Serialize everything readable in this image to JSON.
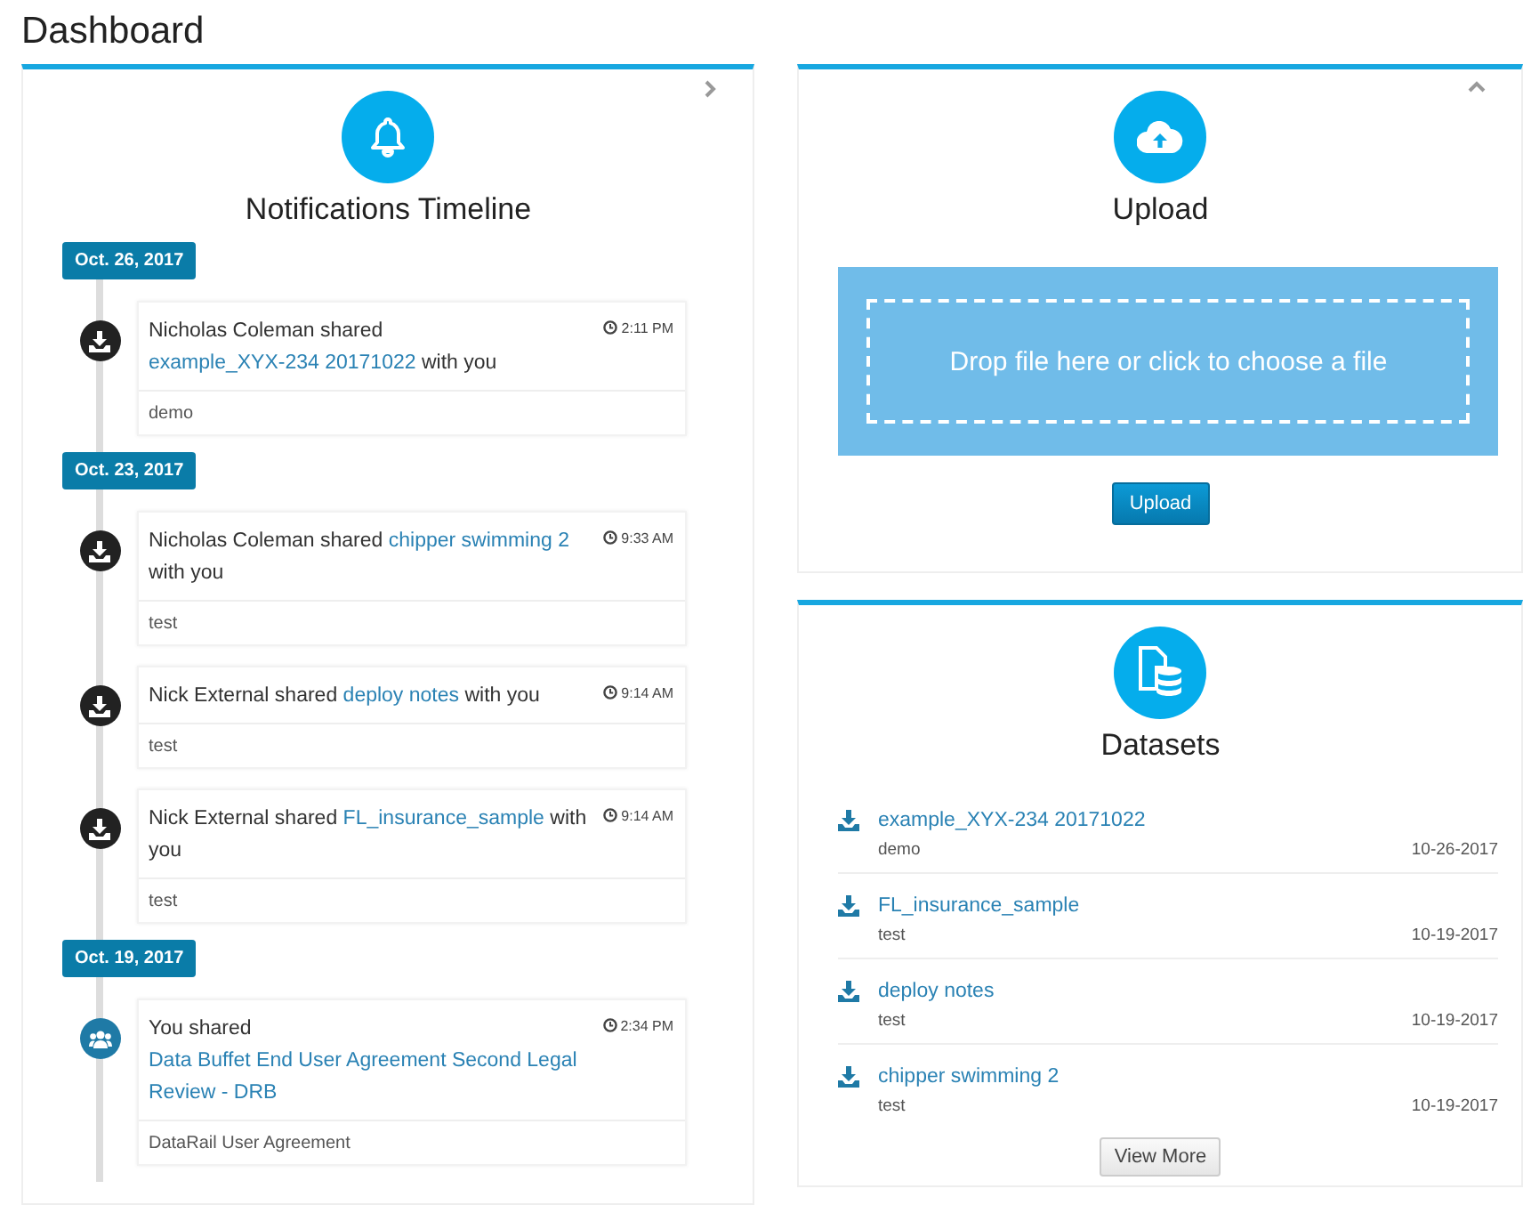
{
  "page": {
    "title": "Dashboard"
  },
  "notifications": {
    "title": "Notifications Timeline",
    "groups": [
      {
        "date": "Oct. 26, 2017",
        "items": [
          {
            "kind": "download",
            "before": "Nicholas Coleman shared ",
            "link": "example_XYX-234 20171022",
            "after": " with you",
            "time": "2:11 PM",
            "note": "demo"
          }
        ]
      },
      {
        "date": "Oct. 23, 2017",
        "items": [
          {
            "kind": "download",
            "before": "Nicholas Coleman shared ",
            "link": "chipper swimming 2",
            "after": " with you",
            "time": "9:33 AM",
            "note": "test"
          },
          {
            "kind": "download",
            "before": "Nick External shared ",
            "link": "deploy notes",
            "after": " with you",
            "time": "9:14 AM",
            "note": "test"
          },
          {
            "kind": "download",
            "before": "Nick External shared ",
            "link": "FL_insurance_sample",
            "after": " with you",
            "time": "9:14 AM",
            "note": "test"
          }
        ]
      },
      {
        "date": "Oct. 19, 2017",
        "items": [
          {
            "kind": "group",
            "before": "You shared ",
            "link": "Data Buffet End User Agreement Second Legal Review - DRB",
            "time": "2:34 PM",
            "note": "DataRail User Agreement"
          }
        ]
      }
    ]
  },
  "upload": {
    "title": "Upload",
    "dropzone": "Drop file here or click to choose a file",
    "button": "Upload"
  },
  "datasets": {
    "title": "Datasets",
    "rows": [
      {
        "name": "example_XYX-234 20171022",
        "tag": "demo",
        "date": "10-26-2017"
      },
      {
        "name": "FL_insurance_sample",
        "tag": "test",
        "date": "10-19-2017"
      },
      {
        "name": "deploy notes",
        "tag": "test",
        "date": "10-19-2017"
      },
      {
        "name": "chipper swimming 2",
        "tag": "test",
        "date": "10-19-2017"
      }
    ],
    "button": "View More"
  }
}
